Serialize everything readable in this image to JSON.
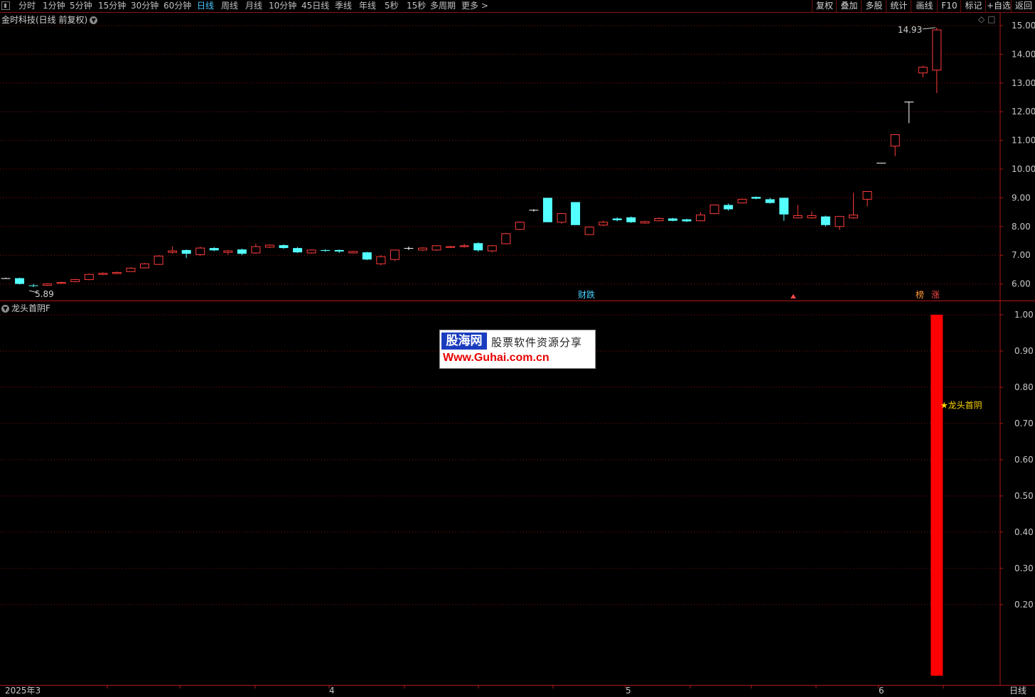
{
  "toolbar": {
    "left_items": [
      {
        "label": "分时"
      },
      {
        "label": "1分钟"
      },
      {
        "label": "5分钟"
      },
      {
        "label": "15分钟"
      },
      {
        "label": "30分钟"
      },
      {
        "label": "60分钟"
      },
      {
        "label": "日线",
        "active": true
      },
      {
        "label": "周线"
      },
      {
        "label": "月线"
      },
      {
        "label": "10分钟"
      },
      {
        "label": "45日线"
      },
      {
        "label": "季线"
      },
      {
        "label": "年线"
      },
      {
        "label": "5秒"
      },
      {
        "label": "15秒"
      },
      {
        "label": "多周期"
      },
      {
        "label": "更多 >"
      }
    ],
    "right_items": [
      {
        "label": "复权"
      },
      {
        "label": "叠加"
      },
      {
        "label": "多股"
      },
      {
        "label": "统计"
      },
      {
        "label": "画线"
      },
      {
        "label": "F10"
      },
      {
        "label": "标记"
      },
      {
        "label": "+自选"
      },
      {
        "label": "返回"
      }
    ]
  },
  "main_chart": {
    "title": "金时科技(日线 前复权)",
    "y_ticks": [
      "15.00",
      "14.00",
      "13.00",
      "12.00",
      "11.00",
      "10.00",
      "9.00",
      "8.00",
      "7.00",
      "6.00"
    ],
    "high_label": "14.93",
    "low_label": "5.89",
    "event_markers": [
      {
        "label": "财跌",
        "color": "#49d2ff"
      },
      {
        "label": "榜",
        "color": "#ff9a3c"
      },
      {
        "label": "涨",
        "color": "#ff4a4a"
      }
    ]
  },
  "indicator": {
    "title": "龙头首阴F",
    "signal_label": "★龙头首阴",
    "y_ticks": [
      "1.00",
      "0.90",
      "0.80",
      "0.70",
      "0.60",
      "0.50",
      "0.40",
      "0.30",
      "0.20"
    ],
    "signal_value": 1.0
  },
  "x_axis": {
    "labels": [
      "2025年3",
      "4",
      "5",
      "6"
    ]
  },
  "period_badge": "日线",
  "watermark": {
    "logo": "股海网",
    "slogan": "股票软件资源分享",
    "url": "Www.Guhai.com.cn"
  },
  "colors": {
    "up": "#ff3b3b",
    "down": "#54ffff",
    "flat": "#ffffff",
    "grid": "#8a1414",
    "signal": "#ff0000"
  },
  "chart_data": {
    "type": "candlestick",
    "bars": [
      [
        6.2,
        6.2,
        6.22,
        6.18
      ],
      [
        6.2,
        6.0,
        6.22,
        5.98
      ],
      [
        5.95,
        5.93,
        6.0,
        5.89
      ],
      [
        5.95,
        6.0,
        6.02,
        5.93
      ],
      [
        6.02,
        6.05,
        6.08,
        6.0
      ],
      [
        6.08,
        6.15,
        6.18,
        6.06
      ],
      [
        6.15,
        6.33,
        6.36,
        6.13
      ],
      [
        6.33,
        6.37,
        6.4,
        6.31
      ],
      [
        6.36,
        6.4,
        6.43,
        6.34
      ],
      [
        6.43,
        6.55,
        6.58,
        6.42
      ],
      [
        6.56,
        6.7,
        6.73,
        6.54
      ],
      [
        6.68,
        6.97,
        7.0,
        6.66
      ],
      [
        7.1,
        7.15,
        7.3,
        7.05
      ],
      [
        7.18,
        7.05,
        7.2,
        6.9
      ],
      [
        7.02,
        7.25,
        7.3,
        6.98
      ],
      [
        7.25,
        7.17,
        7.28,
        7.14
      ],
      [
        7.1,
        7.15,
        7.18,
        7.02
      ],
      [
        7.2,
        7.05,
        7.23,
        7.0
      ],
      [
        7.08,
        7.3,
        7.4,
        7.05
      ],
      [
        7.28,
        7.35,
        7.38,
        7.25
      ],
      [
        7.35,
        7.25,
        7.38,
        7.22
      ],
      [
        7.25,
        7.1,
        7.28,
        7.08
      ],
      [
        7.08,
        7.18,
        7.2,
        7.05
      ],
      [
        7.18,
        7.15,
        7.2,
        7.12
      ],
      [
        7.18,
        7.13,
        7.2,
        7.08
      ],
      [
        7.08,
        7.13,
        7.15,
        7.06
      ],
      [
        7.1,
        6.85,
        7.12,
        6.83
      ],
      [
        6.7,
        6.95,
        7.0,
        6.65
      ],
      [
        6.85,
        7.18,
        7.2,
        6.8
      ],
      [
        7.25,
        7.25,
        7.3,
        7.18
      ],
      [
        7.18,
        7.25,
        7.28,
        7.15
      ],
      [
        7.18,
        7.33,
        7.35,
        7.15
      ],
      [
        7.27,
        7.3,
        7.33,
        7.27
      ],
      [
        7.3,
        7.33,
        7.4,
        7.27
      ],
      [
        7.42,
        7.17,
        7.45,
        7.12
      ],
      [
        7.15,
        7.33,
        7.35,
        7.1
      ],
      [
        7.4,
        7.75,
        7.78,
        7.38
      ],
      [
        7.9,
        8.15,
        8.17,
        7.88
      ],
      [
        8.58,
        8.58,
        8.6,
        8.52
      ],
      [
        9.0,
        8.15,
        9.0,
        8.15
      ],
      [
        8.15,
        8.45,
        8.47,
        8.1
      ],
      [
        8.85,
        8.05,
        8.85,
        8.05
      ],
      [
        7.72,
        7.98,
        8.0,
        7.7
      ],
      [
        8.05,
        8.15,
        8.2,
        8.02
      ],
      [
        8.28,
        8.22,
        8.32,
        8.18
      ],
      [
        8.32,
        8.15,
        8.35,
        8.12
      ],
      [
        8.12,
        8.17,
        8.2,
        8.1
      ],
      [
        8.2,
        8.28,
        8.32,
        8.18
      ],
      [
        8.28,
        8.2,
        8.3,
        8.18
      ],
      [
        8.25,
        8.18,
        8.27,
        8.15
      ],
      [
        8.2,
        8.4,
        8.5,
        8.18
      ],
      [
        8.45,
        8.75,
        8.77,
        8.43
      ],
      [
        8.75,
        8.6,
        8.8,
        8.55
      ],
      [
        8.82,
        8.95,
        8.97,
        8.8
      ],
      [
        9.03,
        8.97,
        9.05,
        8.95
      ],
      [
        8.95,
        8.82,
        9.0,
        8.8
      ],
      [
        9.0,
        8.42,
        9.0,
        8.2
      ],
      [
        8.3,
        8.38,
        8.75,
        8.28
      ],
      [
        8.3,
        8.38,
        8.52,
        8.27
      ],
      [
        8.35,
        8.05,
        8.38,
        8.0
      ],
      [
        8.0,
        8.35,
        8.35,
        7.88
      ],
      [
        8.3,
        8.4,
        9.18,
        8.27
      ],
      [
        8.95,
        9.22,
        9.22,
        8.7
      ],
      [
        10.22,
        10.22,
        10.22,
        10.22
      ],
      [
        10.8,
        11.2,
        11.2,
        10.45
      ],
      [
        12.35,
        12.35,
        12.35,
        11.6
      ],
      [
        13.35,
        13.55,
        13.6,
        13.2
      ],
      [
        13.45,
        14.85,
        14.93,
        12.65
      ]
    ]
  }
}
